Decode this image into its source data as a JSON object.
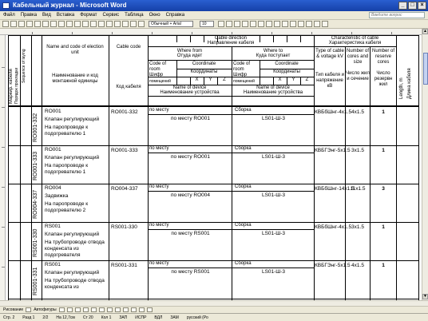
{
  "window": {
    "title": "Кабельный журнал - Microsoft Word",
    "controls": [
      "_",
      "□",
      "×"
    ]
  },
  "menu": {
    "items": [
      "Файл",
      "Правка",
      "Вид",
      "Вставка",
      "Формат",
      "Сервис",
      "Таблица",
      "Окно",
      "Справка"
    ],
    "help_placeholder": "Введите вопрос"
  },
  "toolbar": {
    "style": "Обычный + Arial",
    "size": "10"
  },
  "statusbar": {
    "items": [
      "Стр. 2",
      "Разд 1",
      "2/2",
      "На 12,7см",
      "Ст 20",
      "Кол 1",
      "ЗАП",
      "ИСПР",
      "ВДЛ",
      "ЗАМ",
      "русский (Ро"
    ]
  },
  "drawbar": {
    "draw_label": "Рисование",
    "autoshapes_label": "Автофигуры"
  },
  "table": {
    "header": {
      "col_cable_mark": "Маркир. кабеля",
      "col_sequence": "Порядок прокладки",
      "col_sequence_en": "Sequence of laying",
      "col_name_en": "Name and code of election unit",
      "col_name_ru": "Наименование и код монтажной единицы",
      "col_code_en": "Cable code",
      "col_code_ru": "Код кабеля",
      "direction_en": "Cable direction",
      "direction_ru": "Направление кабеля",
      "where_from_en": "Where from",
      "where_from_ru": "Отуда идет",
      "where_to_en": "Where to",
      "where_to_ru": "Куда поступает",
      "room_code_en": "Code of room",
      "room_code_ru": "Шифр",
      "room_code_ru2": "помещений",
      "coords_en": "Coordinate",
      "coords_ru": "Координаты",
      "x": "X",
      "y": "Y",
      "z": "Z",
      "device_en": "Name of device",
      "device_ru": "Наименование устройства",
      "char_en": "Characteristic of cable",
      "char_ru": "Характеристика кабеля",
      "type_en": "Type of cable & voltage kV",
      "type_ru": "Тип кабеля и напряжение кВ",
      "cores_en": "Number of cores and size",
      "cores_ru": "Число жил и сечение",
      "reserve_en": "Number of reserve cores",
      "reserve_ru": "Число резервн жил",
      "length_en": "Length, m",
      "length_ru": "Длина кабеля"
    },
    "rows": [
      {
        "mark": "RO001-332",
        "unit": "RO001",
        "desc": "Клапан регулирующий",
        "loc": "На паропроводе к подогревателю 1",
        "code": "RO001-332",
        "from_room": "по месту",
        "from_device": "по месту RO001",
        "to_room": "Сборка",
        "to_device": "LS01-Ш-3",
        "type": "КВБбШнг-4х1.5",
        "cores": "4х1.5",
        "reserve": "1"
      },
      {
        "mark": "RO001-333",
        "unit": "RO001",
        "desc": "Клапан регулирующий",
        "loc": "На паропроводе к подогревателю 1",
        "code": "RO001-333",
        "from_room": "по месту",
        "from_device": "по месту RO001",
        "to_room": "Сборка",
        "to_device": "LS01-Ш-3",
        "type": "КВБГЭнг-5х1.5",
        "cores": "3х1.5",
        "reserve": "1"
      },
      {
        "mark": "RO004-337",
        "unit": "RO004",
        "desc": "Задвижка",
        "loc": "На паропроводе к подогревателю 2",
        "code": "RO004-337",
        "from_room": "по месту",
        "from_device": "по месту RO004",
        "to_room": "Сборка",
        "to_device": "LS01-Ш-3",
        "type": "КВБбШнг-14х1.5",
        "cores": "11х1.5",
        "reserve": "3"
      },
      {
        "mark": "RS001-330",
        "unit": "RS001",
        "desc": "Клапан регулирующий",
        "loc": "На трубопроводе отвода конденсата из подогревателя",
        "code": "RS001-330",
        "from_room": "по месту",
        "from_device": "по месту RS001",
        "to_room": "Сборка",
        "to_device": "LS01-Ш-3",
        "type": "КВБбШнг-4х1.5",
        "cores": "3х1.5",
        "reserve": "1"
      },
      {
        "mark": "RS001-331",
        "unit": "RS001",
        "desc": "Клапан регулирующий",
        "loc": "На трубопроводе отвода конденсата из",
        "code": "RS001-331",
        "from_room": "по месту",
        "from_device": "по месту RS001",
        "to_room": "Сборка",
        "to_device": "LS01-Ш-3",
        "type": "КВБГЭнг-5х1.5",
        "cores": "4х1.5",
        "reserve": "1"
      }
    ]
  }
}
